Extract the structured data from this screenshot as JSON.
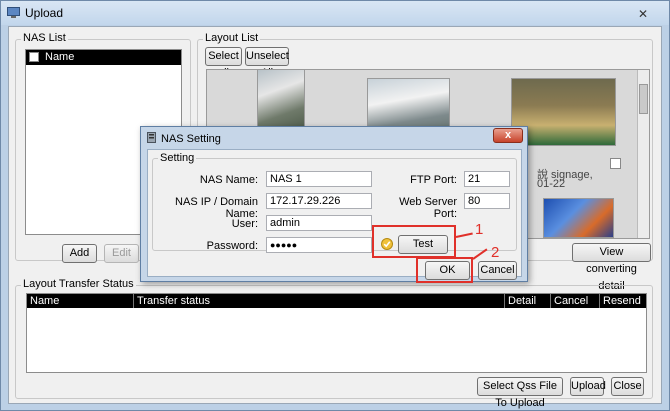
{
  "window": {
    "title": "Upload",
    "close_glyph": "✕"
  },
  "nas_list": {
    "group_label": "NAS List",
    "column_name": "Name",
    "add_label": "Add",
    "edit_label": "Edit"
  },
  "layout_list": {
    "group_label": "Layout List",
    "select_all_label": "Select all",
    "unselect_all_label": "Unselect All",
    "caption_line1": "說 signage,",
    "caption_line2": "01-22",
    "view_converting_label": "View converting detail"
  },
  "transfer": {
    "group_label": "Layout Transfer Status",
    "columns": [
      "Name",
      "Transfer status",
      "Detail",
      "Cancel",
      "Resend"
    ],
    "select_qss_label": "Select Qss File To Upload",
    "upload_label": "Upload",
    "close_label": "Close"
  },
  "dialog": {
    "title": "NAS Setting",
    "close_glyph": "x",
    "group_label": "Setting",
    "nas_name_label": "NAS Name:",
    "nas_name_value": "NAS 1",
    "ip_label": "NAS IP / Domain Name:",
    "ip_value": "172.17.29.226",
    "user_label": "User:",
    "user_value": "admin",
    "password_label": "Password:",
    "password_value": "●●●●●",
    "ftp_port_label": "FTP Port:",
    "ftp_port_value": "21",
    "web_port_label": "Web Server Port:",
    "web_port_value": "80",
    "test_label": "Test",
    "ok_label": "OK",
    "cancel_label": "Cancel"
  },
  "annotations": {
    "one": "1",
    "two": "2",
    "color": "#e0302a"
  }
}
